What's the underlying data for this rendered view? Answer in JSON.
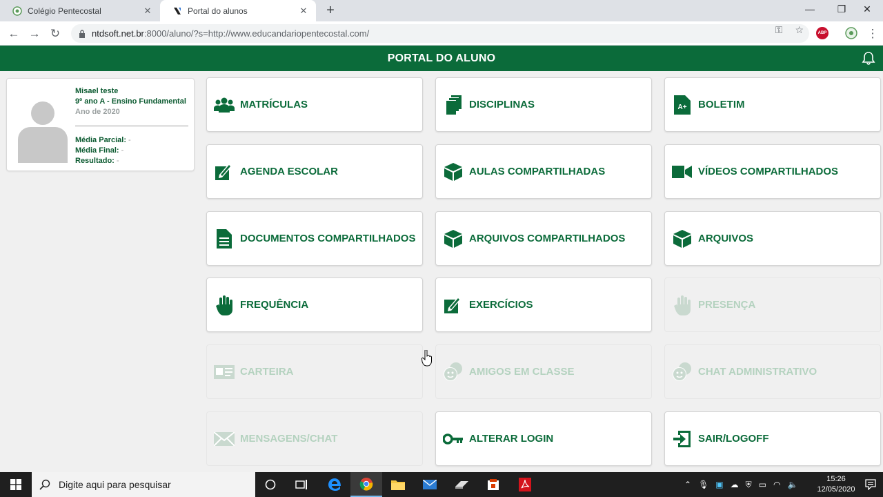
{
  "browser": {
    "tabs": [
      {
        "title": "Colégio Pentecostal",
        "active": false
      },
      {
        "title": "Portal do alunos",
        "active": true
      }
    ],
    "url_main": "ntdsoft.net.br",
    "url_rest": ":8000/aluno/?s=http://www.educandariopentecostal.com/",
    "extensions": {
      "abp": "ABP"
    }
  },
  "header": {
    "title": "PORTAL DO ALUNO"
  },
  "student": {
    "name": "Misael teste",
    "class": "9º ano A - Ensino Fundamental",
    "year": "Ano de 2020",
    "partial_label": "Média Parcial:",
    "partial_value": " -",
    "final_label": "Média Final:",
    "final_value": " -",
    "result_label": "Resultado:",
    "result_value": " -"
  },
  "tiles": [
    {
      "label": "MATRÍCULAS",
      "icon": "users-group-icon",
      "enabled": true
    },
    {
      "label": "DISCIPLINAS",
      "icon": "documents-stack-icon",
      "enabled": true
    },
    {
      "label": "BOLETIM",
      "icon": "grade-file-icon",
      "enabled": true
    },
    {
      "label": "AGENDA ESCOLAR",
      "icon": "edit-pencil-icon",
      "enabled": true
    },
    {
      "label": "AULAS COMPARTILHADAS",
      "icon": "cube-icon",
      "enabled": true
    },
    {
      "label": "VÍDEOS COMPARTILHADOS",
      "icon": "video-camera-icon",
      "enabled": true
    },
    {
      "label": "DOCUMENTOS COMPARTILHADOS",
      "icon": "document-icon",
      "enabled": true
    },
    {
      "label": "ARQUIVOS COMPARTILHADOS",
      "icon": "cube-icon",
      "enabled": true
    },
    {
      "label": "ARQUIVOS",
      "icon": "cube-icon",
      "enabled": true
    },
    {
      "label": "FREQUÊNCIA",
      "icon": "hand-icon",
      "enabled": true
    },
    {
      "label": "EXERCÍCIOS",
      "icon": "edit-pencil-icon",
      "enabled": true
    },
    {
      "label": "PRESENÇA",
      "icon": "hand-icon",
      "enabled": false
    },
    {
      "label": "CARTEIRA",
      "icon": "id-card-icon",
      "enabled": false
    },
    {
      "label": "AMIGOS EM CLASSE",
      "icon": "chat-face-icon",
      "enabled": false
    },
    {
      "label": "CHAT ADMINISTRATIVO",
      "icon": "chat-face-icon",
      "enabled": false
    },
    {
      "label": "MENSAGENS/CHAT",
      "icon": "envelope-icon",
      "enabled": false
    },
    {
      "label": "ALTERAR LOGIN",
      "icon": "key-icon",
      "enabled": true
    },
    {
      "label": "SAIR/LOGOFF",
      "icon": "logout-icon",
      "enabled": true
    }
  ],
  "taskbar": {
    "search_placeholder": "Digite aqui para pesquisar",
    "time": "15:26",
    "date": "12/05/2020"
  },
  "colors": {
    "brand_green": "#0b6b3a",
    "disabled_green": "#b4d2bf"
  }
}
